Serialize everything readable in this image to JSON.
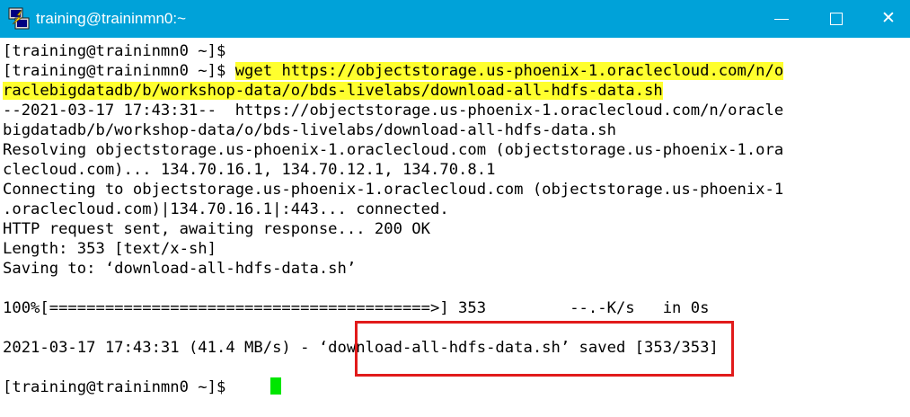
{
  "window": {
    "title": "training@traininmn0:~",
    "icon": "putty-icon",
    "controls": {
      "minimize": "minimize-icon",
      "maximize": "maximize-icon",
      "close": "close-icon",
      "close_glyph": "✕"
    }
  },
  "colors": {
    "titlebar": "#00a2d9",
    "highlight": "#ffff2e",
    "cursor": "#00e600",
    "annotation_box": "#e11b1b"
  },
  "terminal": {
    "lines": [
      {
        "id": "prompt-1",
        "text": "[training@traininmn0 ~]$"
      },
      {
        "id": "cmd-prompt",
        "text": "[training@traininmn0 ~]$ "
      },
      {
        "id": "cmd-part1",
        "text": "wget https://objectstorage.us-phoenix-1.oraclecloud.com/n/o"
      },
      {
        "id": "cmd-part2",
        "text": "raclebigdatadb/b/workshop-data/o/bds-livelabs/download-all-hdfs-data.sh"
      },
      {
        "id": "out-1",
        "text": "--2021-03-17 17:43:31--  https://objectstorage.us-phoenix-1.oraclecloud.com/n/oracle"
      },
      {
        "id": "out-2",
        "text": "bigdatadb/b/workshop-data/o/bds-livelabs/download-all-hdfs-data.sh"
      },
      {
        "id": "out-3",
        "text": "Resolving objectstorage.us-phoenix-1.oraclecloud.com (objectstorage.us-phoenix-1.ora"
      },
      {
        "id": "out-4",
        "text": "clecloud.com)... 134.70.16.1, 134.70.12.1, 134.70.8.1"
      },
      {
        "id": "out-5",
        "text": "Connecting to objectstorage.us-phoenix-1.oraclecloud.com (objectstorage.us-phoenix-1"
      },
      {
        "id": "out-6",
        "text": ".oraclecloud.com)|134.70.16.1|:443... connected."
      },
      {
        "id": "out-7",
        "text": "HTTP request sent, awaiting response... 200 OK"
      },
      {
        "id": "out-8",
        "text": "Length: 353 [text/x-sh]"
      },
      {
        "id": "out-9",
        "text": "Saving to: ‘download-all-hdfs-data.sh’"
      },
      {
        "id": "progress",
        "text": "100%[=========================================>] 353         --.-K/s   in 0s"
      },
      {
        "id": "saved",
        "text": "2021-03-17 17:43:31 (41.4 MB/s) - ‘download-all-hdfs-data.sh’ saved [353/353]"
      },
      {
        "id": "prompt-final",
        "text": "[training@traininmn0 ~]$ "
      }
    ]
  }
}
